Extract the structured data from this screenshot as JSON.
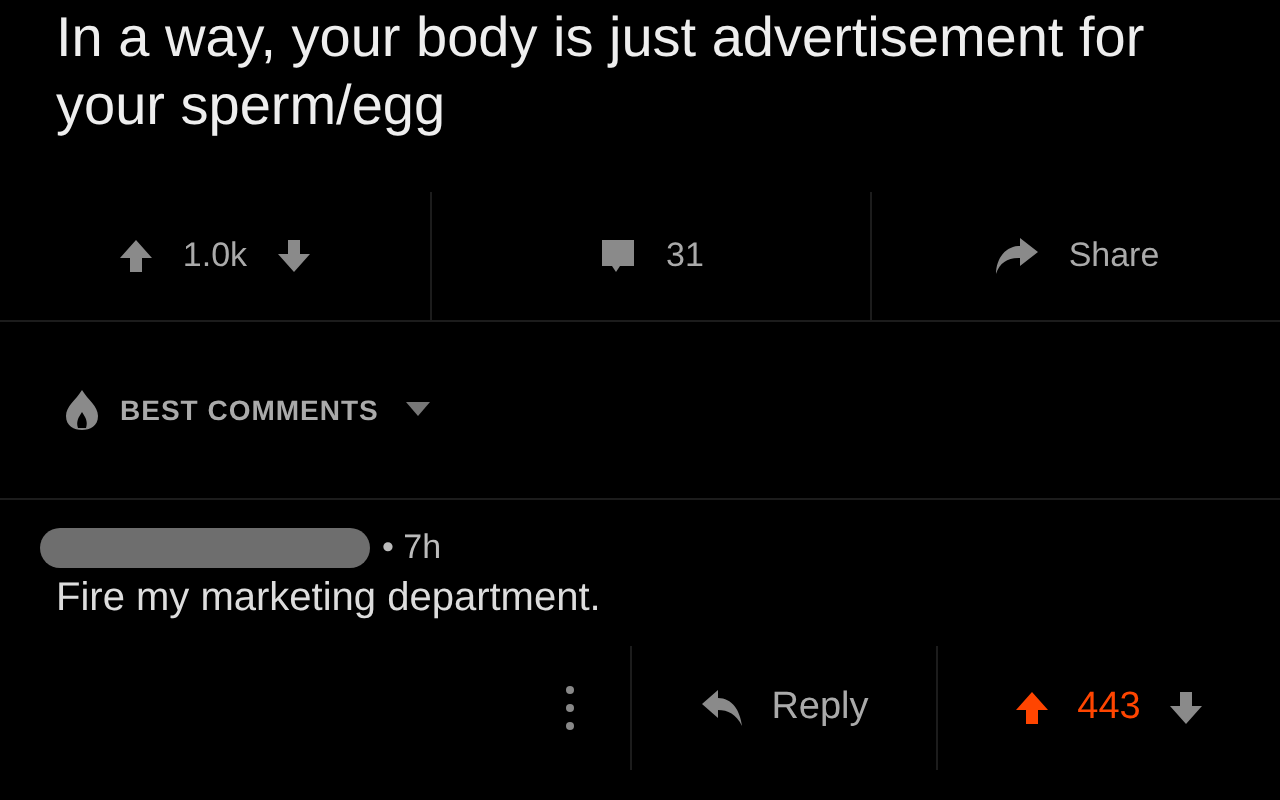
{
  "post": {
    "title": "In a way, your body is just advertisement for your sperm/egg",
    "score": "1.0k",
    "upvoted": false,
    "comments": "31",
    "share": "Share"
  },
  "sort": {
    "label": "BEST COMMENTS"
  },
  "comment": {
    "age": "• 7h",
    "body": "Fire my marketing department.",
    "reply": "Reply",
    "score": "443",
    "upvoted": true
  }
}
